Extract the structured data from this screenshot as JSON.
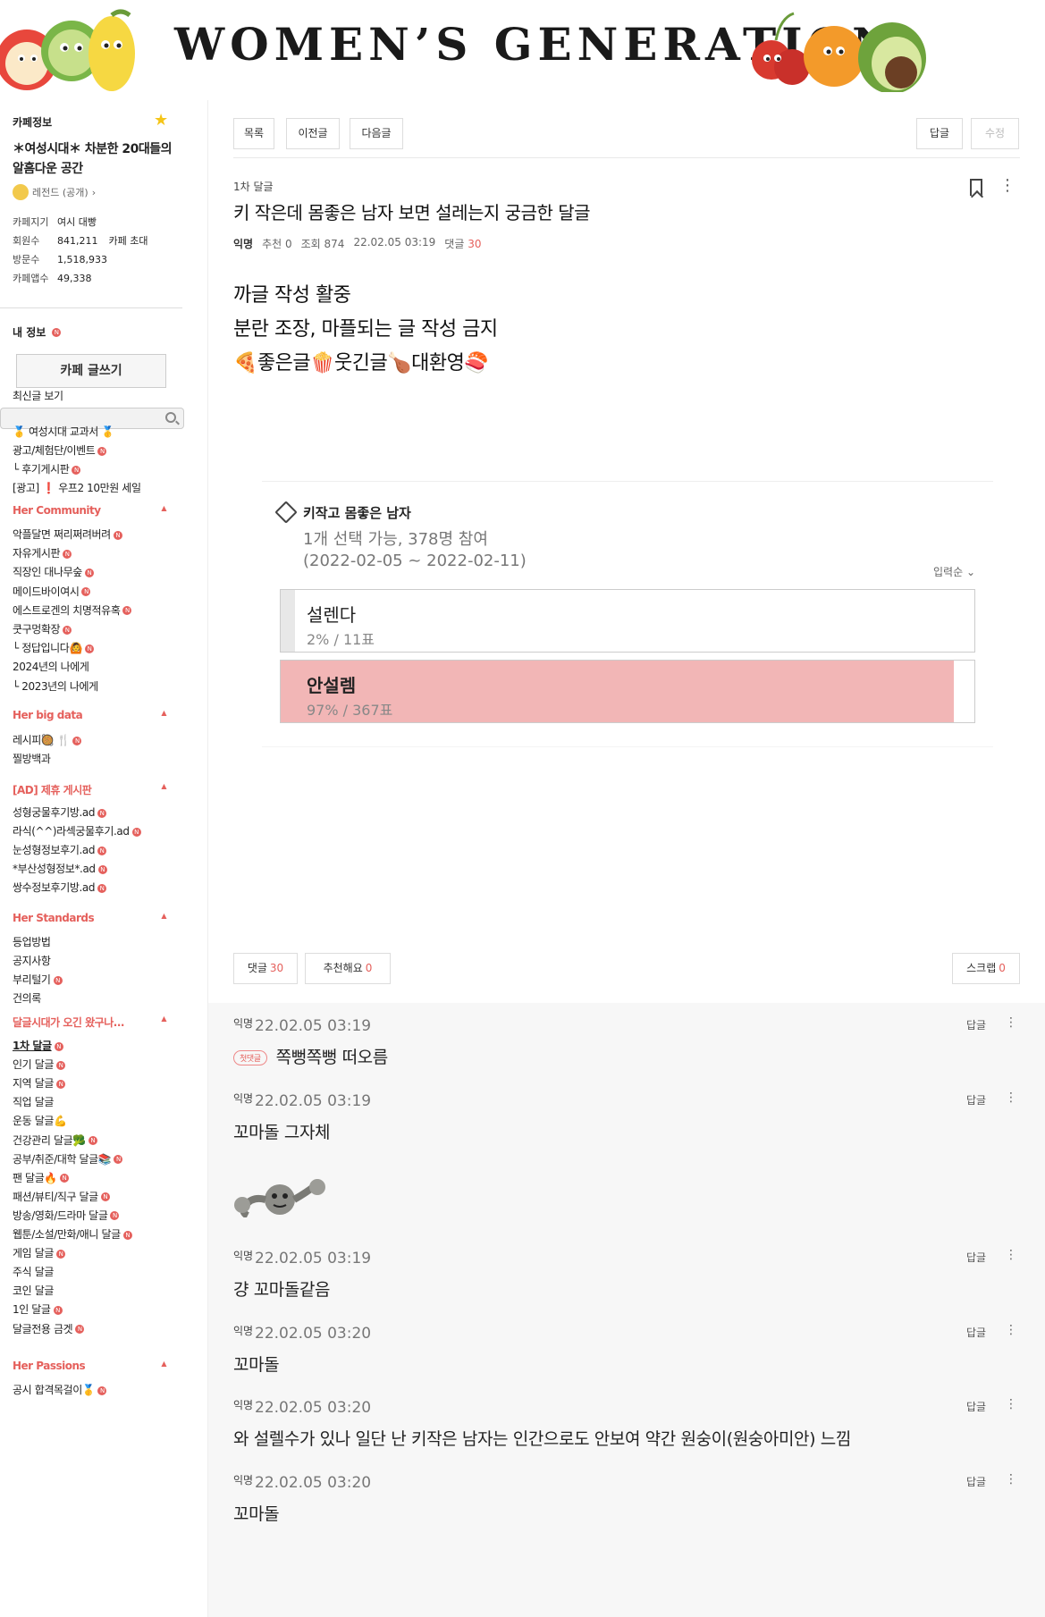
{
  "banner": {
    "title": "WOMEN’S GENERATION"
  },
  "sidebar": {
    "cafe_info_label": "카페정보",
    "cafe_name": "＊여성시대＊ 차분한 20대들의 알흠다운 공간",
    "level": "레전드 (공개)",
    "stats": [
      {
        "k": "카페지기",
        "v": "여시 대빵",
        "extra": ""
      },
      {
        "k": "회원수",
        "v": "841,211",
        "extra": "카페 초대"
      },
      {
        "k": "방문수",
        "v": "1,518,933",
        "extra": ""
      },
      {
        "k": "카페앱수",
        "v": "49,338",
        "extra": ""
      }
    ],
    "my_info": "내 정보",
    "write_button": "카페 글쓰기",
    "latest": "최신글 보기",
    "items_top": [
      "🥇 여성시대 교과서 🥇",
      "광고/체험단/이벤트",
      "└ 후기게시판",
      "[광고] ❗ 우프2 10만원 세일"
    ],
    "sec_community": "Her Community",
    "community": [
      "악플달면 쩌리쩌려버려",
      "자유게시판",
      "직장인 대나무숲",
      "메이드바이여시",
      "에스트로겐의 치명적유혹",
      "쿳구멍확장",
      "└ 정답입니다🙆",
      "2024년의 나에게",
      "└ 2023년의 나에게"
    ],
    "sec_bigdata": "Her big data",
    "bigdata": [
      "레시피🥘 🍴",
      "찔방백과"
    ],
    "sec_ad": "[AD] 제휴 게시판",
    "ad": [
      "성형궁물후기방.ad",
      "라식(^^)라섹궁물후기.ad",
      "눈성형정보후기.ad",
      "*부산성형정보*.ad",
      "쌍수정보후기방.ad"
    ],
    "sec_standards": "Her Standards",
    "standards": [
      "등업방법",
      "공지사항",
      "부리털기",
      "건의록"
    ],
    "sec_dalgeul": "달글시대가 오긴 왔구나...",
    "dalgeul": [
      "1차 달글",
      "인기 달글",
      "지역 달글",
      "직업 달글",
      "운동 달글💪",
      "건강관리 달글🥦",
      "공부/취준/대학 달글📚",
      "팬 달글🔥",
      "패션/뷰티/직구 달글",
      "방송/영화/드라마 달글",
      "웹툰/소설/만화/애니 달글",
      "게임 달글",
      "주식 달글",
      "코인 달글",
      "1인 달글",
      "달글전용 금겟"
    ],
    "sec_passions": "Her Passions",
    "passions": [
      "공시 합격목걸이🥇"
    ],
    "new_badge": "N"
  },
  "toolbar": {
    "list": "목록",
    "prev": "이전글",
    "next": "다음글",
    "reply": "답글",
    "edit": "수정"
  },
  "post": {
    "board": "1차 달글",
    "title": "키 작은데 몸좋은 남자 보면 설레는지 궁금한 달글",
    "author": "익명",
    "recommend": "추천 0",
    "views": "조회 874",
    "date": "22.02.05 03:19",
    "comments_label": "댓글",
    "comments_count": "30",
    "body": [
      "까글 작성 활중",
      "분란 조장, 마플되는 글 작성 금지",
      "🍕좋은글🍿웃긴글🍗대환영🍣"
    ]
  },
  "poll": {
    "title": "키작고 몸좋은 남자",
    "info1": "1개 선택 가능, 378명 참여",
    "info2": "(2022-02-05 ~ 2022-02-11)",
    "sort": "입력순",
    "options": [
      {
        "label": "설렌다",
        "result": "2% / 11표",
        "percent": 2,
        "color": "#e8e8e8"
      },
      {
        "label": "안설렘",
        "result": "97% / 367표",
        "percent": 97,
        "color": "#f2b6b6"
      }
    ]
  },
  "actions": {
    "comment": "댓글",
    "comment_count": "30",
    "like": "추천해요",
    "like_count": "0",
    "scrap": "스크랩",
    "scrap_count": "0"
  },
  "comments": [
    {
      "author": "익명",
      "date": "22.02.05 03:19",
      "text": "쪽뻥쪽뻥 떠오름",
      "badge": "첫댓글"
    },
    {
      "author": "익명",
      "date": "22.02.05 03:19",
      "text": "꼬마돌 그자체",
      "badge": ""
    },
    {
      "author": "익명",
      "date": "22.02.05 03:19",
      "text": "걍 꼬마돌같음",
      "badge": ""
    },
    {
      "author": "익명",
      "date": "22.02.05 03:20",
      "text": "꼬마돌",
      "badge": ""
    },
    {
      "author": "익명",
      "date": "22.02.05 03:20",
      "text": "와 설렐수가 있나 일단 난 키작은 남자는 인간으로도 안보여 약간 원숭이(원숭아미안) 느낌",
      "badge": ""
    },
    {
      "author": "익명",
      "date": "22.02.05 03:20",
      "text": "꼬마돌",
      "badge": ""
    }
  ],
  "comment_reply": "답글"
}
